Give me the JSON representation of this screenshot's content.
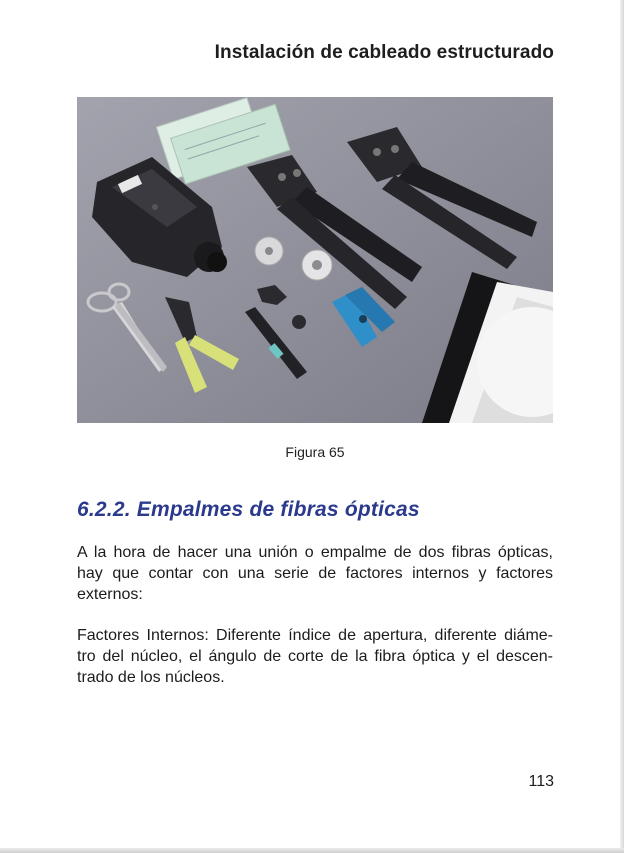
{
  "header": {
    "running_title": "Instalación de cableado estructurado"
  },
  "figure": {
    "caption": "Figura 65",
    "colors": {
      "background": "#8f8f9a",
      "tool_black": "#222226",
      "cutter_yellow": "#d8e07a",
      "stripper_blue": "#2f8fc8"
    }
  },
  "section": {
    "heading": "6.2.2.  Empalmes de fibras ópticas",
    "paragraph_1": {
      "lines": [
        "A la hora de hacer una unión o empalme de dos fibras ópticas,",
        "hay que contar con una serie de factores internos y factores",
        "externos:"
      ]
    },
    "paragraph_2": {
      "lines": [
        "Factores Internos: Diferente índice de apertura, diferente diáme-",
        "tro del núcleo, el ángulo de corte de la fibra óptica y el descen-",
        "trado de los núcleos."
      ]
    }
  },
  "footer": {
    "page_number": "113"
  },
  "theme": {
    "heading_color": "#2b3a8c",
    "text_color": "#1c1c1c"
  }
}
